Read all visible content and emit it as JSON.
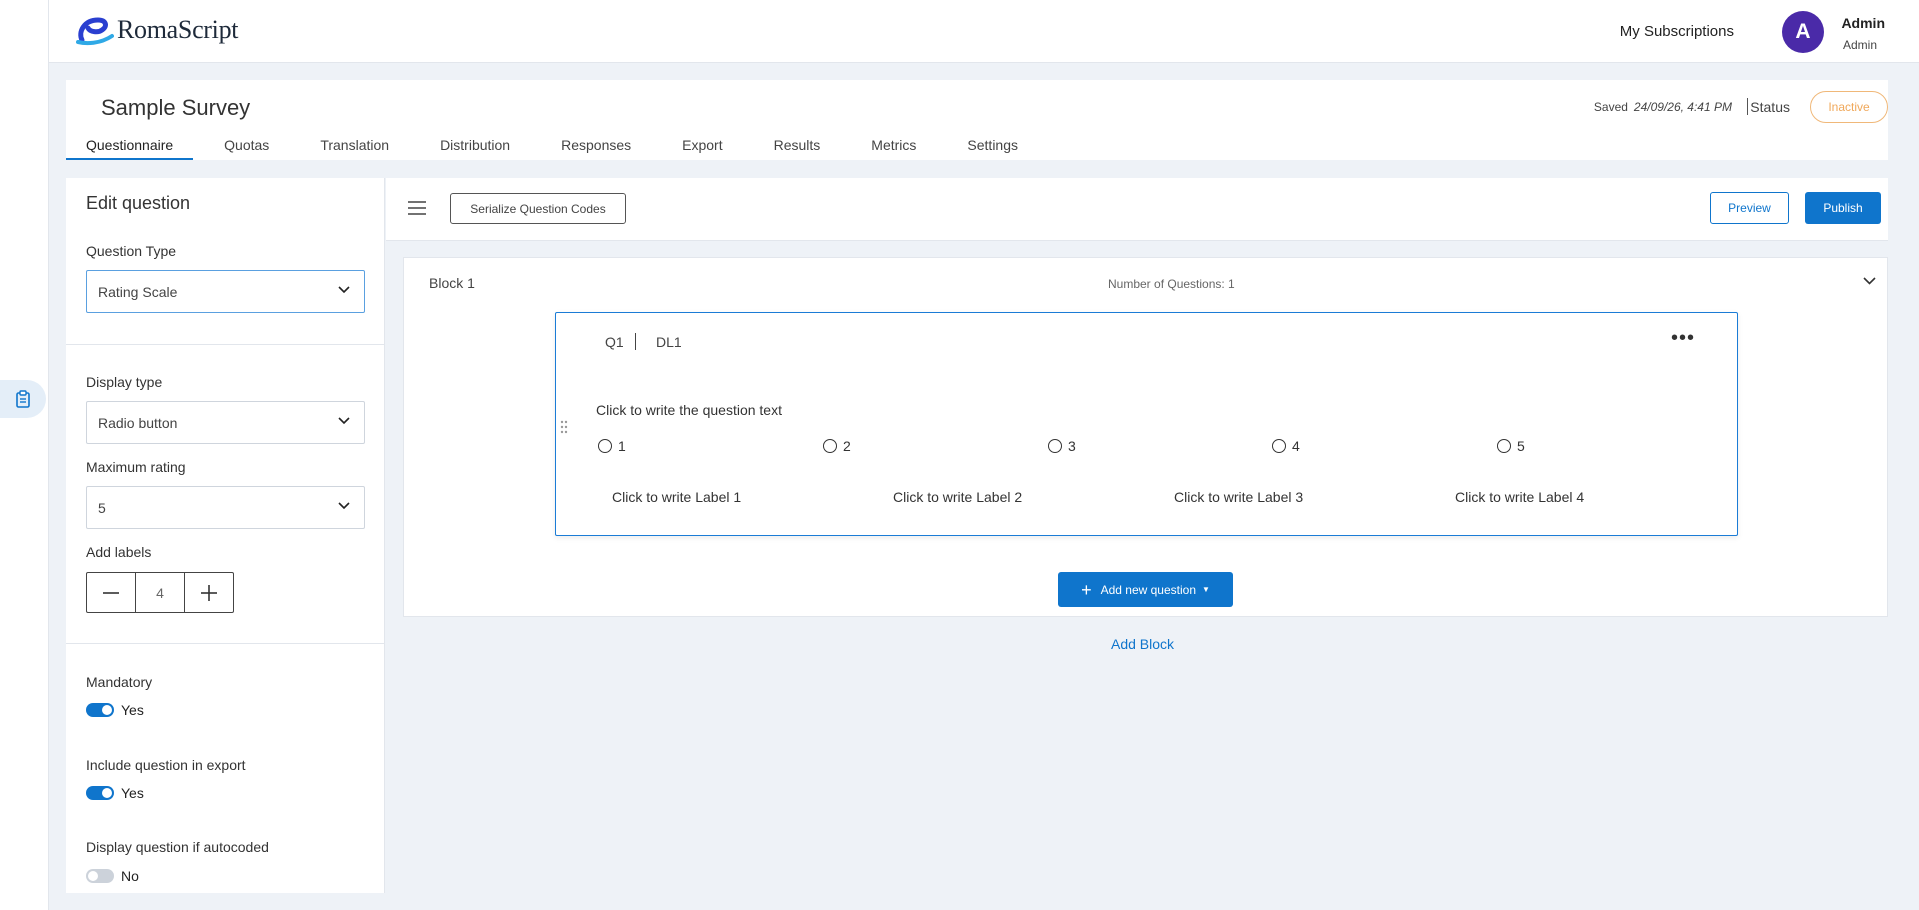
{
  "brand": {
    "name": "RomaScript",
    "logo_color": "#2a3fd0"
  },
  "header": {
    "my_subscriptions": "My Subscriptions",
    "user": {
      "initial": "A",
      "name": "Admin",
      "role": "Admin",
      "avatar_color": "#4a2aa8"
    }
  },
  "survey": {
    "title": "Sample Survey",
    "saved_label": "Saved",
    "saved_time": "24/09/26, 4:41 PM",
    "status_label": "Status",
    "status_value": "Inactive",
    "tabs": [
      {
        "label": "Questionnaire",
        "active": true
      },
      {
        "label": "Quotas"
      },
      {
        "label": "Translation"
      },
      {
        "label": "Distribution"
      },
      {
        "label": "Responses"
      },
      {
        "label": "Export"
      },
      {
        "label": "Results"
      },
      {
        "label": "Metrics"
      },
      {
        "label": "Settings"
      }
    ]
  },
  "edit_panel": {
    "title": "Edit question",
    "question_type_label": "Question Type",
    "question_type_value": "Rating Scale",
    "display_type_label": "Display type",
    "display_type_value": "Radio button",
    "max_rating_label": "Maximum rating",
    "max_rating_value": "5",
    "add_labels_label": "Add labels",
    "add_labels_value": "4",
    "mandatory_label": "Mandatory",
    "mandatory_value": "Yes",
    "include_export_label": "Include question in export",
    "include_export_value": "Yes",
    "autocoded_label": "Display question if autocoded",
    "autocoded_value": "No"
  },
  "toolbar": {
    "serialize_label": "Serialize Question Codes",
    "preview_label": "Preview",
    "publish_label": "Publish"
  },
  "block": {
    "title": "Block 1",
    "count_text": "Number of Questions: 1",
    "question": {
      "code": "Q1",
      "dl": "DL1",
      "text": "Click to write the question text",
      "options": [
        "1",
        "2",
        "3",
        "4",
        "5"
      ],
      "labels": [
        "Click to write Label 1",
        "Click to write Label 2",
        "Click to write Label 3",
        "Click to write Label 4"
      ]
    }
  },
  "actions": {
    "add_question": "Add new question",
    "add_block": "Add Block"
  },
  "colors": {
    "accent": "#0f75cc",
    "status_inactive": "#f0a85a"
  }
}
